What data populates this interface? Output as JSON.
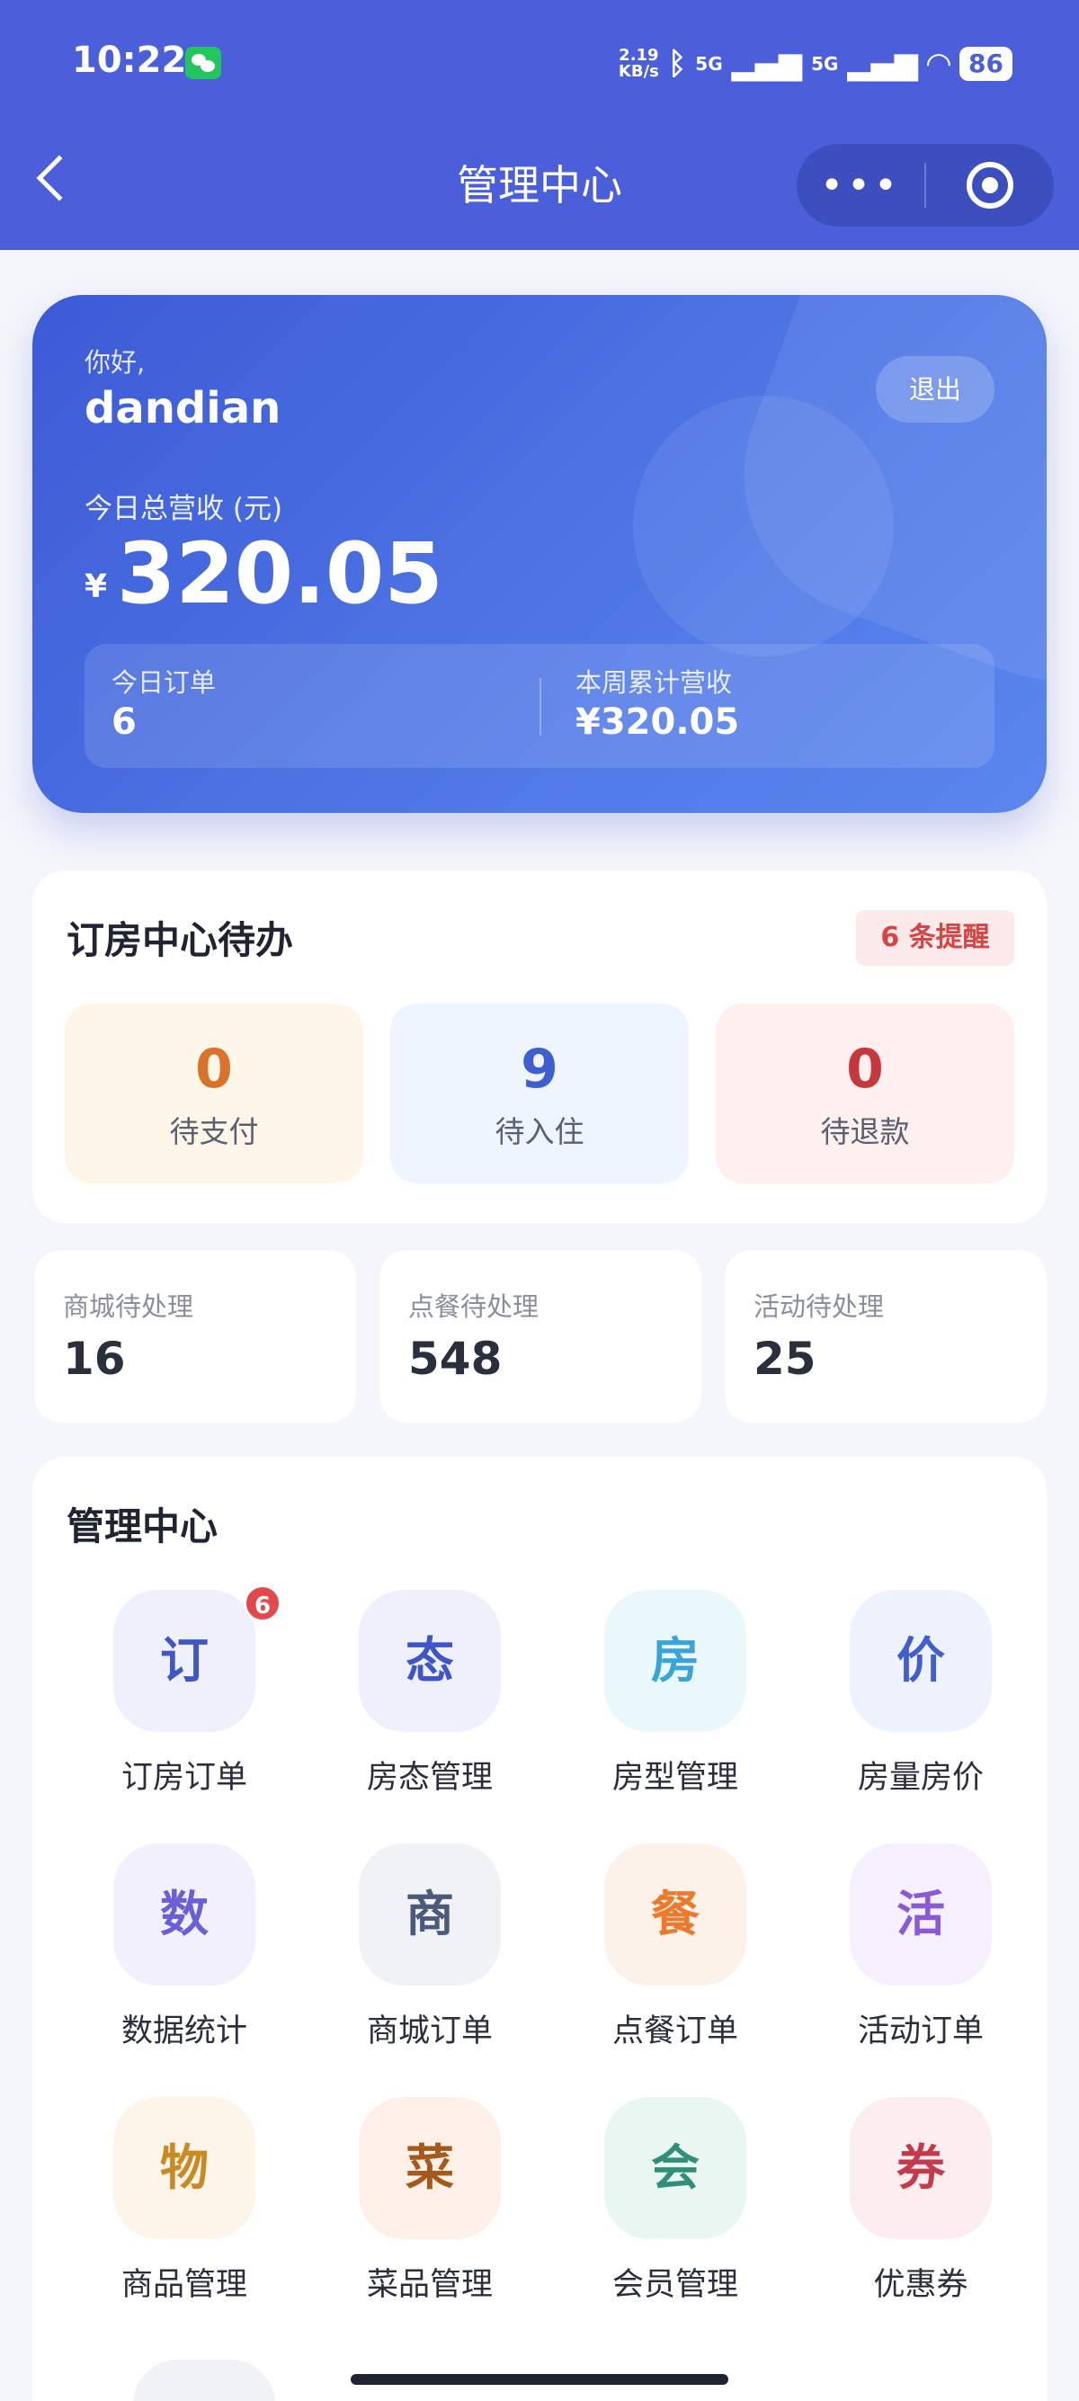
{
  "status_bar": {
    "time": "10:22",
    "net_speed_value": "2.19",
    "net_speed_unit": "KB/s",
    "signal_1": "5G",
    "signal_2": "5G",
    "battery": "86"
  },
  "nav": {
    "title": "管理中心",
    "more_label": "•••"
  },
  "revenue_card": {
    "greeting": "你好,",
    "username": "dandian",
    "logout_label": "退出",
    "revenue_label": "今日总营收 (元)",
    "currency": "¥",
    "revenue_value": "320.05",
    "today_orders_label": "今日订单",
    "today_orders_value": "6",
    "week_revenue_label": "本周累计营收",
    "week_revenue_value": "¥320.05"
  },
  "booking_todo": {
    "title": "订房中心待办",
    "reminder_badge": "6 条提醒",
    "items": [
      {
        "value": "0",
        "label": "待支付",
        "color": "#d9732a",
        "bg": "#fff6ea"
      },
      {
        "value": "9",
        "label": "待入住",
        "color": "#3f5fd0",
        "bg": "#eef5fe"
      },
      {
        "value": "0",
        "label": "待退款",
        "color": "#c6383d",
        "bg": "#fdf0ef"
      }
    ]
  },
  "pending_stats": [
    {
      "label": "商城待处理",
      "value": "16"
    },
    {
      "label": "点餐待处理",
      "value": "548"
    },
    {
      "label": "活动待处理",
      "value": "25"
    }
  ],
  "management": {
    "title": "管理中心",
    "tiles": [
      {
        "char": "订",
        "label": "订房订单",
        "color": "#3f55c8",
        "bg": "#eef0fc",
        "badge": "6"
      },
      {
        "char": "态",
        "label": "房态管理",
        "color": "#3f55c8",
        "bg": "#eef0fc"
      },
      {
        "char": "房",
        "label": "房型管理",
        "color": "#3aa3d8",
        "bg": "#eaf8fb"
      },
      {
        "char": "价",
        "label": "房量房价",
        "color": "#3f5fd0",
        "bg": "#eef2fc"
      },
      {
        "char": "数",
        "label": "数据统计",
        "color": "#6a5fd6",
        "bg": "#f1f0fc"
      },
      {
        "char": "商",
        "label": "商城订单",
        "color": "#4b5a78",
        "bg": "#f1f2f6"
      },
      {
        "char": "餐",
        "label": "点餐订单",
        "color": "#ea7a2c",
        "bg": "#fdf2ea"
      },
      {
        "char": "活",
        "label": "活动订单",
        "color": "#8a5ad6",
        "bg": "#f5f0fd"
      },
      {
        "char": "物",
        "label": "商品管理",
        "color": "#c98a24",
        "bg": "#fdf4ea"
      },
      {
        "char": "菜",
        "label": "菜品管理",
        "color": "#a45a1a",
        "bg": "#fdf0e8"
      },
      {
        "char": "会",
        "label": "会员管理",
        "color": "#2f8f78",
        "bg": "#eaf6f2"
      },
      {
        "char": "券",
        "label": "优惠券",
        "color": "#c53a4a",
        "bg": "#fcedef"
      }
    ]
  }
}
